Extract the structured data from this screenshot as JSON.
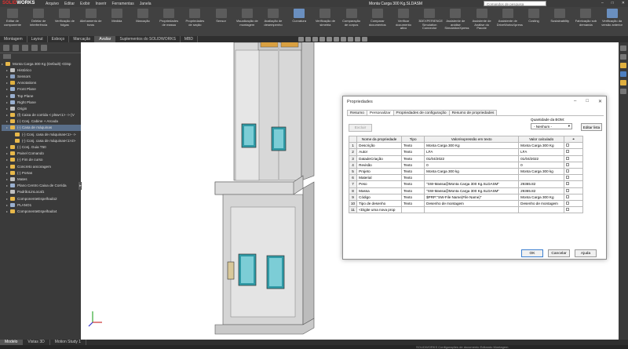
{
  "app": {
    "logo_solid": "SOLID",
    "logo_works": "WORKS",
    "menus": [
      "Arquivo",
      "Editar",
      "Exibir",
      "Inserir",
      "Ferramentas",
      "Janela"
    ],
    "document_title": "Monta Carga 300 Kg.SLDASM",
    "search_placeholder": "Comandos de pesquisa"
  },
  "ribbon": [
    "Editar de componente",
    "Deletar de interferência",
    "Verificação de folgas",
    "Alinhamento de furos",
    "Medida",
    "Marcação",
    "Propriedades de massa",
    "Propriedades de seção",
    "Sensor",
    "Visualização de montagem",
    "Avaliação de desempenho",
    "Curvatura",
    "Verificação de simetria",
    "Comparação de corpos",
    "Comparar documentos",
    "Verificar documento ativo",
    "3DEXPERIENCE Simulation Connector",
    "Assistente de análise SimulationXpress",
    "Assistente de Análise do Pacote",
    "Assistente de DriveWorksXpress",
    "Costing",
    "Sustainability",
    "Fabricação sob demanda",
    "Verificação da versão anterior"
  ],
  "command_tabs": [
    "Montagem",
    "Layout",
    "Esboço",
    "Marcação",
    "Avaliar",
    "Suplementos do SOLIDWORKS",
    "MBD"
  ],
  "feature_tree": [
    {
      "label": "Monta Carga 300 Kg (Default) <Disp",
      "level": 0,
      "color": "#e8b84a"
    },
    {
      "label": "Histórico",
      "level": 1,
      "color": "#c0c0c0"
    },
    {
      "label": "Sensors",
      "level": 1,
      "color": "#8aa0c0"
    },
    {
      "label": "Annotations",
      "level": 1,
      "color": "#e0b040"
    },
    {
      "label": "Front Plane",
      "level": 1,
      "color": "#9ab0d0"
    },
    {
      "label": "Top Plane",
      "level": 1,
      "color": "#9ab0d0"
    },
    {
      "label": "Right Plane",
      "level": 1,
      "color": "#9ab0d0"
    },
    {
      "label": "Origin",
      "level": 1,
      "color": "#c0c0c0"
    },
    {
      "label": "(f) Caixa de corrida < plsw<1> -> {V",
      "level": 1,
      "color": "#e8b84a"
    },
    {
      "label": "(-) Conj. Cabine + Arcada",
      "level": 1,
      "color": "#e8b84a"
    },
    {
      "label": "(-) Casa de máquinas",
      "level": 1,
      "color": "#e8b84a"
    },
    {
      "label": "(-) Conj. casa de máquinas<1> ->",
      "level": 2,
      "color": "#e8b84a"
    },
    {
      "label": "(-) Conj. casa de máquinas<1>2>",
      "level": 2,
      "color": "#e8b84a"
    },
    {
      "label": "(-) Conj. Guia T50",
      "level": 1,
      "color": "#e8b84a"
    },
    {
      "label": "Painel Comando",
      "level": 1,
      "color": "#e8b84a"
    },
    {
      "label": "(-) Fim de curso",
      "level": 1,
      "color": "#e8b84a"
    },
    {
      "label": "Concreto ancoragem",
      "level": 1,
      "color": "#e8b84a"
    },
    {
      "label": "(-) Portas",
      "level": 1,
      "color": "#e8b84a"
    },
    {
      "label": "Mates",
      "level": 1,
      "color": "#c0c0c0"
    },
    {
      "label": "Plano Centro Caixa de Corrida",
      "level": 1,
      "color": "#9ab0d0"
    },
    {
      "label": "PadrãoLinLocal1",
      "level": 1,
      "color": "#c0c0c0"
    },
    {
      "label": "ComponenteEspelhado2",
      "level": 1,
      "color": "#e8b84a"
    },
    {
      "label": "PLANO1",
      "level": 1,
      "color": "#9ab0d0"
    },
    {
      "label": "ComponenteEspelhado4",
      "level": 1,
      "color": "#e8b84a"
    }
  ],
  "dialog": {
    "title": "Propriedades",
    "tabs": [
      "Resumo",
      "Personalizar",
      "Propriedades de configuração",
      "Resumo de propriedades"
    ],
    "delete_button": "Excluir",
    "bom_label": "Quantidade da BOM:",
    "bom_value": "- Nenhum -",
    "edit_list_button": "Editar lista",
    "columns": [
      "Nome da propriedade",
      "Tipo",
      "Valor/expressão em texto",
      "Valor calculado"
    ],
    "rows": [
      {
        "num": "1",
        "name": "Descrição",
        "type": "Texto",
        "value": "Monta Carga 300 Kg",
        "calc": "Monta Carga 300 Kg"
      },
      {
        "num": "2",
        "name": "Autor",
        "type": "Texto",
        "value": "LFA",
        "calc": "LFA"
      },
      {
        "num": "3",
        "name": "DatadeCriação",
        "type": "Texto",
        "value": "01/04/2022",
        "calc": "01/04/2022"
      },
      {
        "num": "4",
        "name": "Revisão",
        "type": "Texto",
        "value": "0",
        "calc": "0"
      },
      {
        "num": "5",
        "name": "Projeto",
        "type": "Texto",
        "value": "Monta Carga 300 kg",
        "calc": "Monta Carga 300 kg"
      },
      {
        "num": "6",
        "name": "Material",
        "type": "Texto",
        "value": "",
        "calc": ""
      },
      {
        "num": "7",
        "name": "Peso",
        "type": "Texto",
        "value": "\"SW-Massa@Monta Carga 300 Kg.SLDASM\"",
        "calc": "29365.82"
      },
      {
        "num": "8",
        "name": "Massa",
        "type": "Texto",
        "value": "\"SW-Massa@Monta Carga 300 Kg.SLDASM\"",
        "calc": "29365.82"
      },
      {
        "num": "9",
        "name": "Código",
        "type": "Texto",
        "value": "$PRP:\"SW-File Name(File Name)\"",
        "calc": "Monta Carga 300 Kg"
      },
      {
        "num": "10",
        "name": "Tipo de desenho",
        "type": "Texto",
        "value": "Desenho de montagem",
        "calc": "Desenho de montagem"
      },
      {
        "num": "11",
        "name": "<Digite uma nova prop",
        "type": "",
        "value": "",
        "calc": ""
      }
    ],
    "ok": "OK",
    "cancel": "Cancelar",
    "help": "Ajuda"
  },
  "status_tabs": [
    "Modelo",
    "Vistas 3D",
    "Motion Study 1"
  ],
  "status_hint": "SOLIDWORKS   Configurações de documento   Editando Montagem"
}
